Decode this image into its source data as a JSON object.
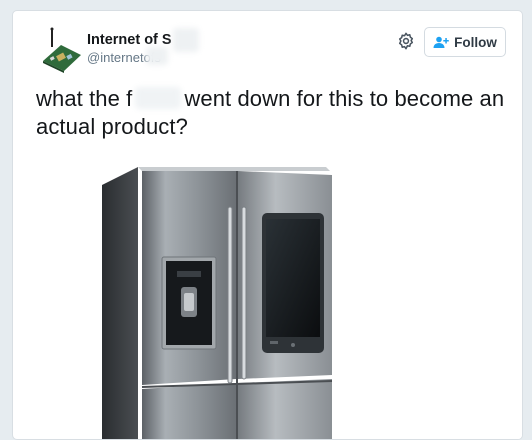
{
  "author": {
    "name": "Internet of S",
    "handle": "@internetofs"
  },
  "follow_button": {
    "label": "Follow"
  },
  "tweet": {
    "text_before": "what the f",
    "text_after": "went down for this to become an actual product?"
  },
  "colors": {
    "background": "#e6ecf0",
    "card": "#ffffff",
    "text": "#14171a",
    "handle": "#657786",
    "follow_icon": "#1da1f2"
  },
  "icons": {
    "settings": "gear-icon",
    "follow": "add-user-icon"
  }
}
